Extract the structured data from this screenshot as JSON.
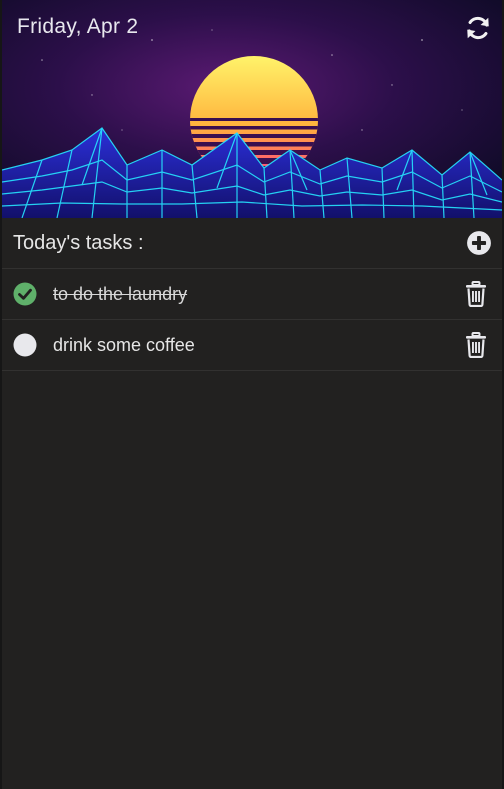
{
  "header": {
    "date": "Friday, Apr 2"
  },
  "tasks_section": {
    "title": "Today's tasks :"
  },
  "tasks": [
    {
      "text": "to do the laundry",
      "done": true
    },
    {
      "text": "drink some coffee",
      "done": false
    }
  ],
  "icons": {
    "refresh": "refresh-icon",
    "add": "plus-circle-icon",
    "done": "check-circle-icon",
    "pending": "empty-circle-icon",
    "delete": "trash-icon"
  },
  "colors": {
    "background": "#222120",
    "done_check": "#5fb06a",
    "pending_circle": "#e8e8ec",
    "text": "#e6e6e6"
  }
}
